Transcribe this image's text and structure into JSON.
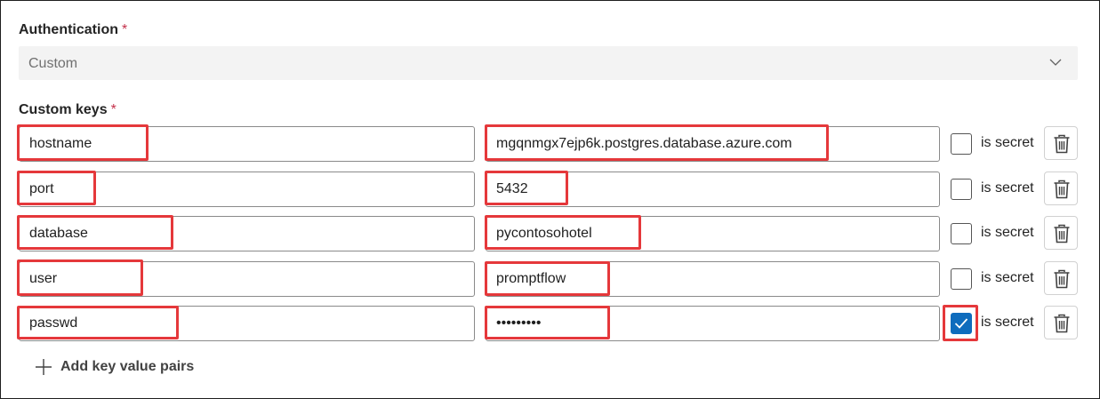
{
  "authentication": {
    "label": "Authentication",
    "required_mark": "*",
    "selected_value": "Custom",
    "chevron_icon": "chevron-down-icon"
  },
  "custom_keys": {
    "label": "Custom keys",
    "required_mark": "*",
    "rows": [
      {
        "key": "hostname",
        "value": "mgqnmgx7ejp6k.postgres.database.azure.com",
        "is_secret_label": "is secret",
        "is_secret": false
      },
      {
        "key": "port",
        "value": "5432",
        "is_secret_label": "is secret",
        "is_secret": false
      },
      {
        "key": "database",
        "value": "pycontosohotel",
        "is_secret_label": "is secret",
        "is_secret": false
      },
      {
        "key": "user",
        "value": "promptflow",
        "is_secret_label": "is secret",
        "is_secret": false
      },
      {
        "key": "passwd",
        "value": "•••••••••",
        "is_secret_label": "is secret",
        "is_secret": true
      }
    ]
  },
  "add_button": {
    "label": "Add key value pairs",
    "icon": "plus-icon"
  },
  "colors": {
    "highlight": "#e5383b",
    "checkbox_checked": "#0f6cbd",
    "required": "#c4314b"
  }
}
